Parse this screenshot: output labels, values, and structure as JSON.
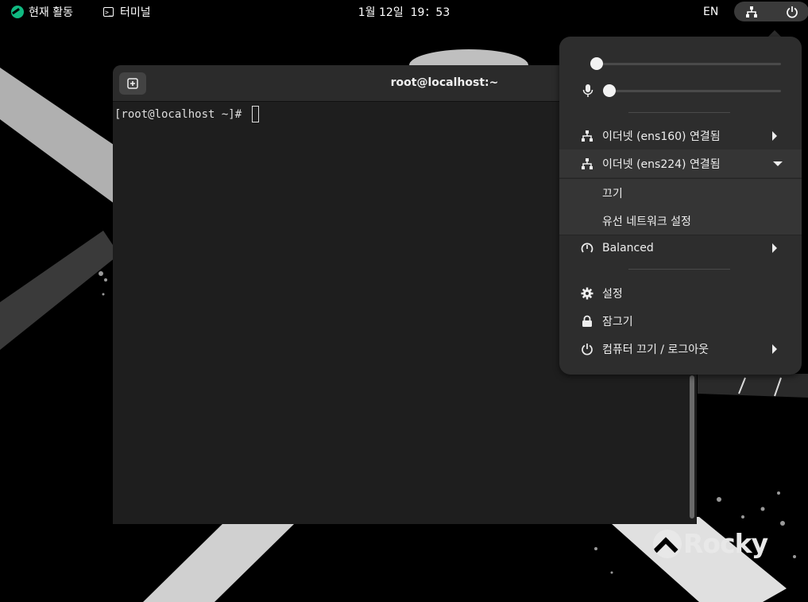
{
  "topbar": {
    "activities_label": "현재 활동",
    "app_menu_label": "터미널",
    "app_menu_icon": "terminal-icon",
    "clock": "1월 12일  19：53",
    "lang": "EN",
    "system_icons": [
      "network-icon",
      "power-icon"
    ]
  },
  "terminal": {
    "title": "root@localhost:~",
    "prompt": "[root@localhost ~]# ",
    "new_tab_icon": "new-tab-icon"
  },
  "quick_settings": {
    "volume_level": 0.0,
    "mic_level": 0.0,
    "items": [
      {
        "label": "이더넷 (ens160) 연결됨",
        "icon": "network-wired-icon",
        "expander": "right"
      },
      {
        "label": "이더넷 (ens224) 연결됨",
        "icon": "network-wired-icon",
        "expander": "down"
      },
      {
        "label": "Balanced",
        "icon": "power-profile-icon",
        "expander": "right"
      },
      {
        "label": "설정",
        "icon": "gear-icon"
      },
      {
        "label": "잠그기",
        "icon": "lock-icon"
      },
      {
        "label": "컴퓨터 끄기 / 로그아웃",
        "icon": "power-icon",
        "expander": "right"
      }
    ],
    "ens224_submenu": [
      "끄기",
      "유선 네트워크 설정"
    ]
  },
  "wallpaper": {
    "logo_text": "Rocky"
  },
  "colors": {
    "accent": "#10b981",
    "panel_bg": "#000000",
    "popover_bg": "#2d2d2d",
    "terminal_bg": "#1e1e1e"
  }
}
